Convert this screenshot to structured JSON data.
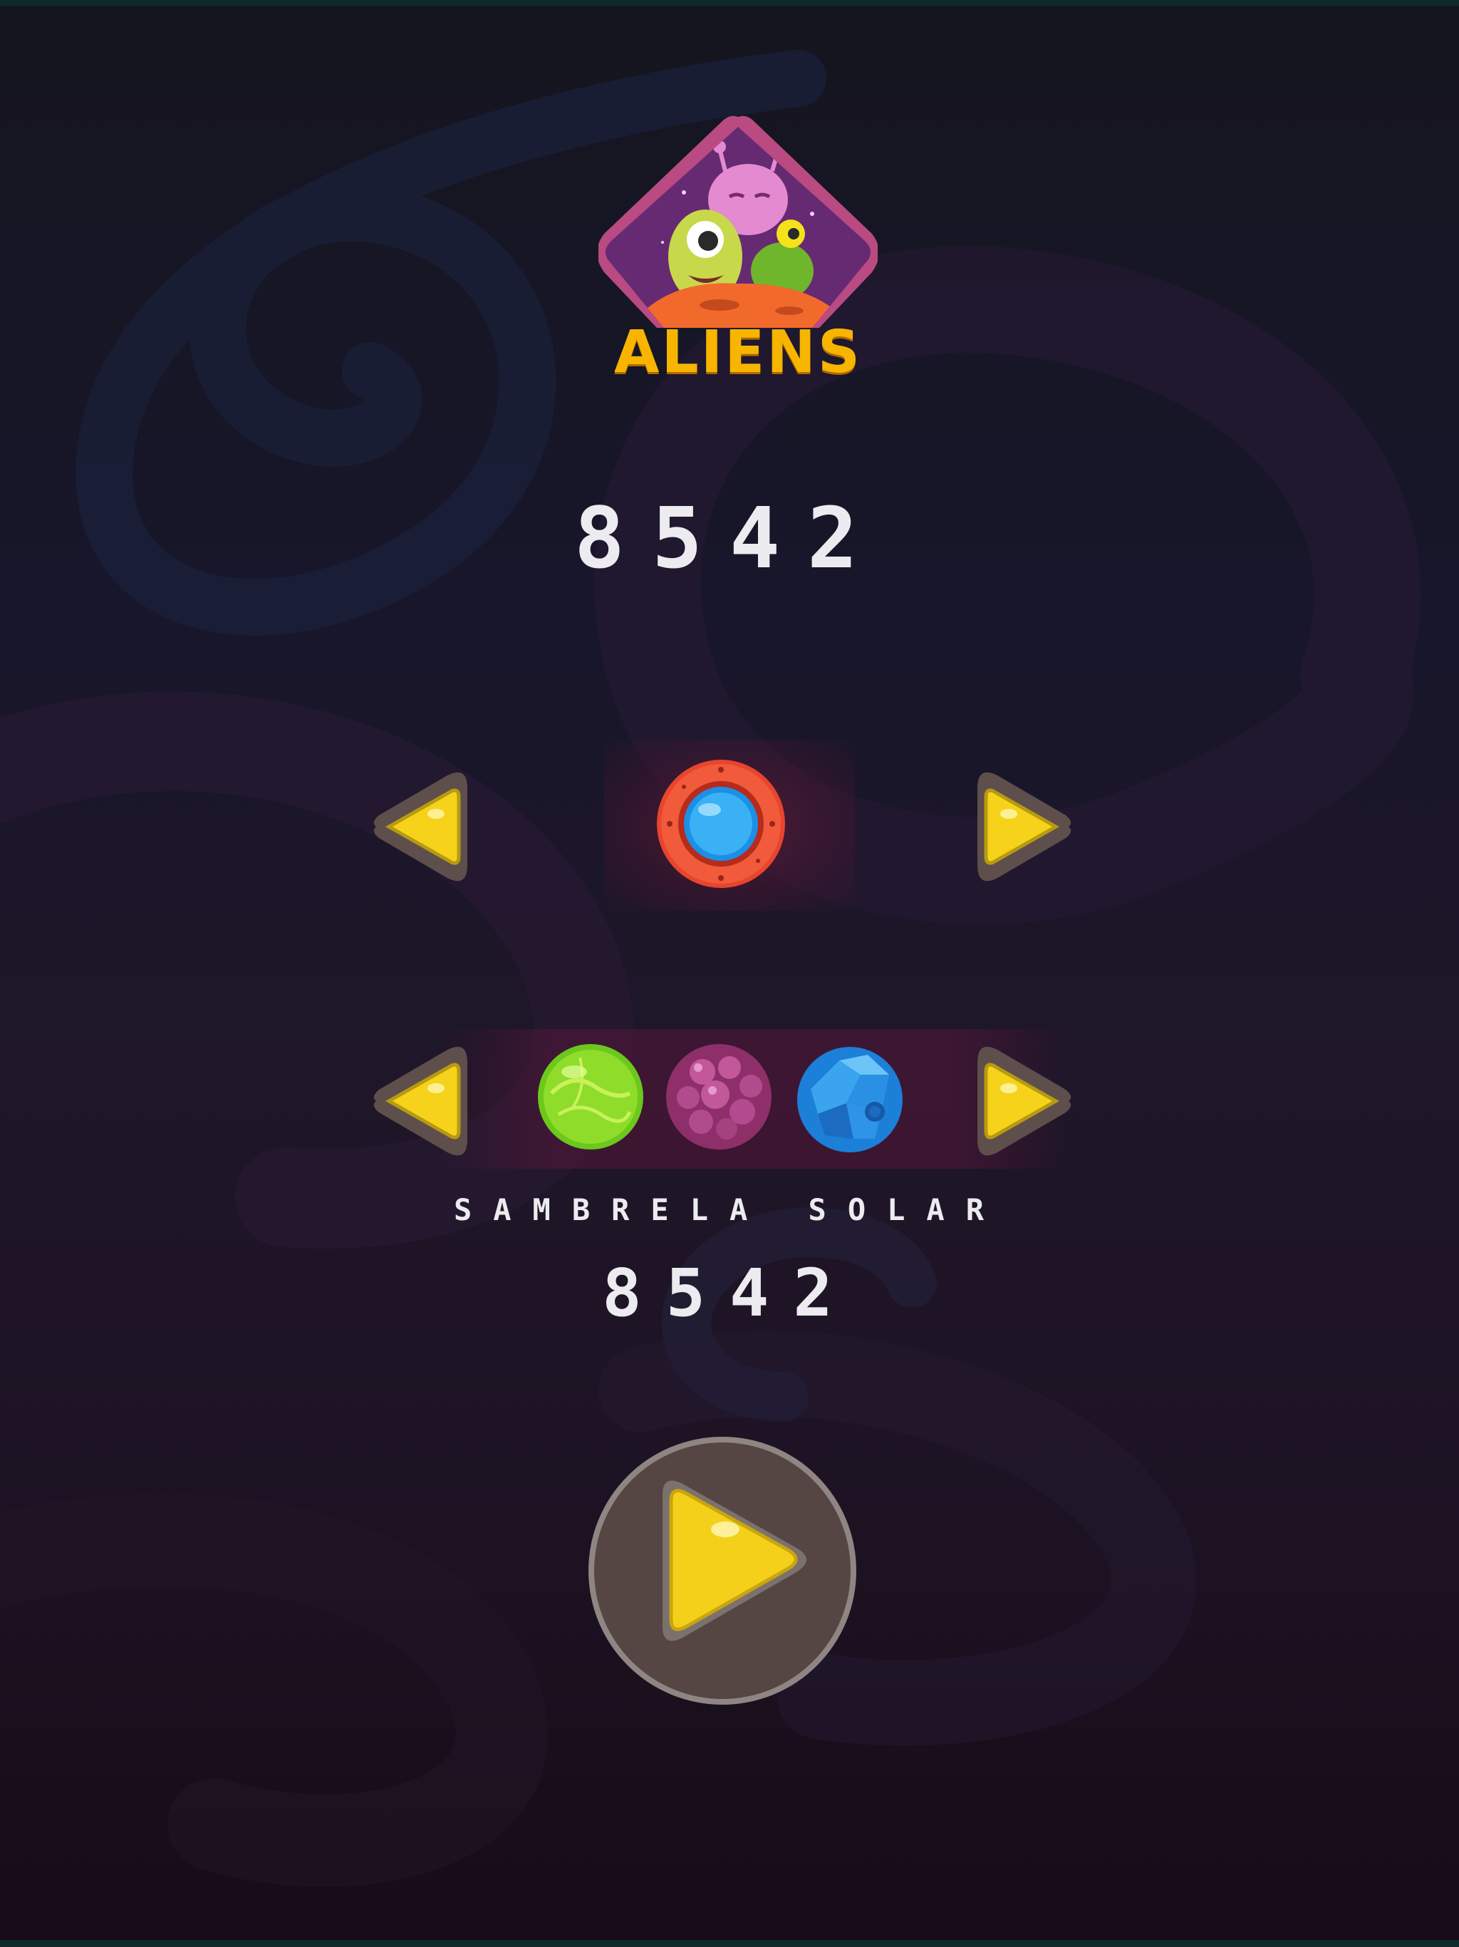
{
  "game": {
    "logo_title": "ALIENS"
  },
  "ship_selector": {
    "score": "8542",
    "prev_icon": "triangle-left-icon",
    "next_icon": "triangle-right-icon",
    "selected_icon": "spaceship-porthole-icon"
  },
  "planet_selector": {
    "planets": [
      {
        "icon": "green-slime-planet-icon"
      },
      {
        "icon": "pink-blob-planet-icon"
      },
      {
        "icon": "blue-crystal-planet-icon"
      }
    ],
    "name": "SAMBRELA SOLAR",
    "score": "8542",
    "prev_icon": "triangle-left-icon",
    "next_icon": "triangle-right-icon"
  },
  "play": {
    "icon": "play-icon"
  },
  "colors": {
    "accent_yellow": "#f7d21a",
    "logo_orange": "#f7b500",
    "button_ring": "#8f8683",
    "button_fill": "#564643",
    "text": "#ecebef"
  }
}
